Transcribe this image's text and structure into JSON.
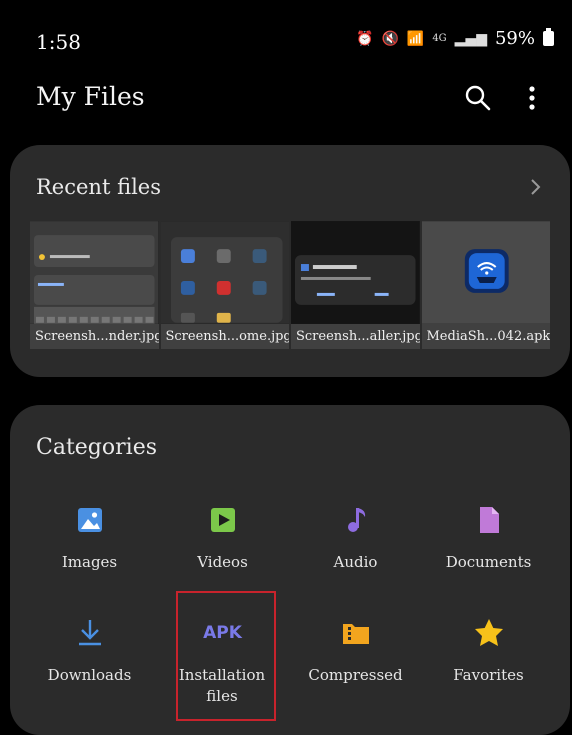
{
  "status": {
    "time": "1:58",
    "network": "4G",
    "battery": "59%"
  },
  "header": {
    "title": "My Files"
  },
  "recent": {
    "title": "Recent files",
    "files": [
      {
        "name": "Screensh...nder.jpg"
      },
      {
        "name": "Screensh...ome.jpg"
      },
      {
        "name": "Screensh...aller.jpg"
      },
      {
        "name": "MediaSh...042.apk"
      }
    ]
  },
  "categories": {
    "title": "Categories",
    "items": [
      {
        "label": "Images",
        "icon": "image-icon",
        "color": "#4a90e2"
      },
      {
        "label": "Videos",
        "icon": "video-icon",
        "color": "#7cc84a"
      },
      {
        "label": "Audio",
        "icon": "music-note-icon",
        "color": "#8e6ce0"
      },
      {
        "label": "Documents",
        "icon": "document-icon",
        "color": "#c07ad8"
      },
      {
        "label": "Downloads",
        "icon": "download-icon",
        "color": "#4a90e2"
      },
      {
        "label": "Installation files",
        "icon": "apk-icon",
        "icon_text": "APK",
        "color": "#7a7ae8"
      },
      {
        "label": "Compressed",
        "icon": "archive-icon",
        "color": "#f2a51e"
      },
      {
        "label": "Favorites",
        "icon": "star-icon",
        "color": "#f7c21a"
      }
    ]
  }
}
